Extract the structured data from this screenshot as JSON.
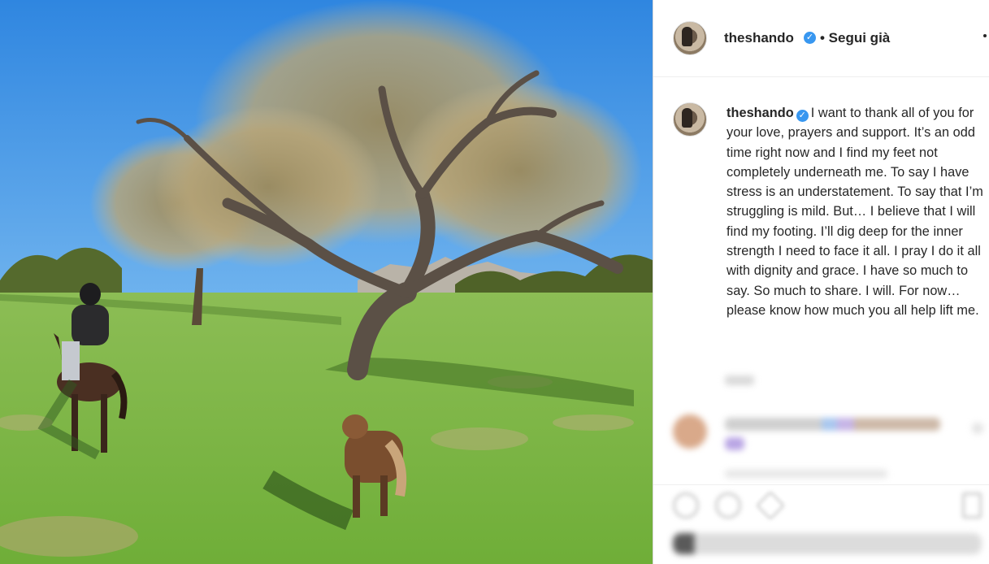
{
  "post": {
    "username": "theshando",
    "verified_mark": "✓",
    "follow_status": "• Segui già",
    "caption": "I want to thank all of you for your love, prayers and support. It’s an odd time right now and I find my feet not completely underneath me. To say I have stress is an understatement. To say that I’m struggling is mild. But… I believe that I will find my footing. I’ll dig deep for the inner strength I need to face it all. I pray I do it all with dignity and grace. I have so much to say. So much to share. I will. For now… please know how much you all help lift me."
  },
  "icons": {
    "verified": "verified-badge-icon",
    "more": "more-options-icon",
    "like": "heart-icon",
    "comment": "comment-icon",
    "share": "share-icon",
    "save": "bookmark-icon"
  },
  "colors": {
    "verified_blue": "#3897f0",
    "sky": "#3f92e3",
    "grass": "#7cb543"
  }
}
